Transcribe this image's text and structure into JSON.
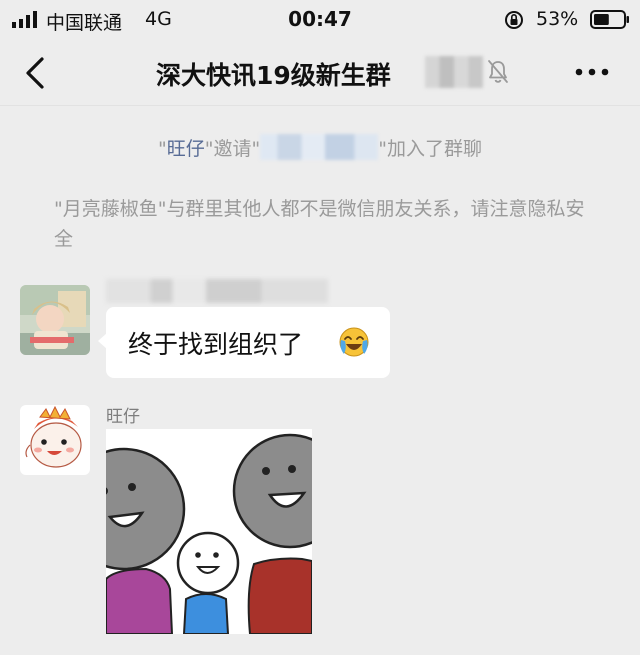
{
  "status_bar": {
    "carrier": "中国联通",
    "network": "4G",
    "time": "00:47",
    "battery_percent": "53%",
    "battery_level": 0.53
  },
  "nav": {
    "title": "深大快讯19级新生群",
    "muted": true
  },
  "system_messages": {
    "invite_quote_open": "\"",
    "inviter": "旺仔",
    "invite_mid": "\"邀请\"",
    "invite_end": "\"加入了群聊",
    "privacy_notice": "\"月亮藤椒鱼\"与群里其他人都不是微信朋友关系，请注意隐私安全"
  },
  "messages": [
    {
      "sender_name": "",
      "text": "终于找到组织了",
      "emoji": "crying-laughing-emoji"
    },
    {
      "sender_name": "旺仔",
      "type": "sticker",
      "sticker": "smiling-stick-figures-sticker"
    }
  ],
  "colors": {
    "background": "#ededed",
    "bubble": "#ffffff",
    "link_name": "#576b95",
    "system_text": "#9a9a9a"
  }
}
